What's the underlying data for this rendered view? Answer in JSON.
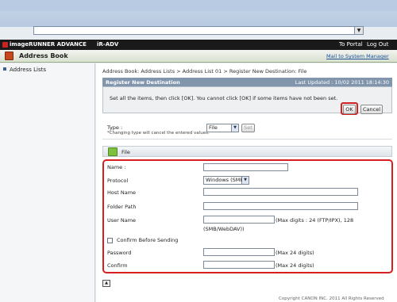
{
  "topbar": {
    "product": "imageRUNNER ADVANCE",
    "device": "iR-ADV",
    "portal_link": "To Portal",
    "logout_link": "Log Out"
  },
  "titlebar": {
    "title": "Address Book",
    "mail_link": "Mail to System Manager"
  },
  "sidebar": {
    "items": [
      {
        "label": "Address Lists"
      }
    ]
  },
  "main": {
    "breadcrumb": "Address Book: Address Lists > Address List 01 > Register New Destination: File",
    "register": {
      "title": "Register New Destination",
      "updated": "Last Updated : 10/02 2011 18:14:30",
      "message": "Set all the items, then click [OK]. You cannot click [OK] if some items have not been set.",
      "ok_label": "OK",
      "cancel_label": "Cancel"
    },
    "type": {
      "label": "Type :",
      "note": "*Changing type will cancel the entered values.",
      "value": "File",
      "set_label": "Set"
    },
    "file_section": {
      "title": "File"
    },
    "form": {
      "name_label": "Name :",
      "protocol_label": "Protocol",
      "protocol_value": "Windows (SMB)",
      "host_label": "Host Name",
      "folder_label": "Folder Path",
      "user_label": "User Name",
      "user_note": "(Max digits : 24 (FTP/IPX), 128",
      "user_note2": "(SMB/WebDAV))",
      "confirm_before_label": "Confirm Before Sending",
      "password_label": "Password",
      "password_note": "(Max 24 digits)",
      "confirm_label": "Confirm",
      "confirm_note": "(Max 24 digits)"
    },
    "footer": "Copyright CANON INC. 2011 All Rights Reserved"
  }
}
